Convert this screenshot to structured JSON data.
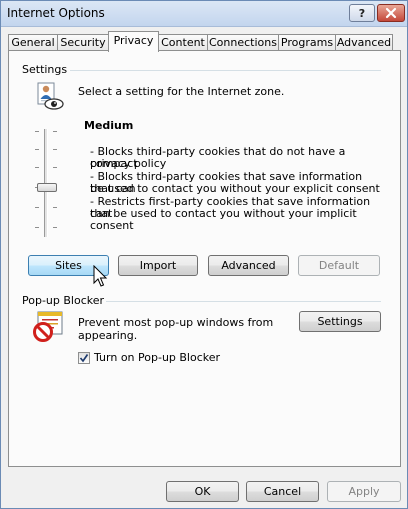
{
  "window": {
    "title": "Internet Options",
    "help_label": "?"
  },
  "tabs": [
    {
      "label": "General",
      "active": false
    },
    {
      "label": "Security",
      "active": false
    },
    {
      "label": "Privacy",
      "active": true
    },
    {
      "label": "Content",
      "active": false
    },
    {
      "label": "Connections",
      "active": false
    },
    {
      "label": "Programs",
      "active": false
    },
    {
      "label": "Advanced",
      "active": false
    }
  ],
  "settings": {
    "group_label": "Settings",
    "instruction": "Select a setting for the Internet zone.",
    "level_name": "Medium",
    "description_lines": [
      "- Blocks third-party cookies that do not have a compact",
      "privacy policy",
      "- Blocks third-party cookies that save information that can",
      "be used to contact you without your explicit consent",
      "- Restricts first-party cookies that save information that",
      "can be used to contact you without your implicit consent"
    ],
    "buttons": {
      "sites": "Sites",
      "import": "Import",
      "advanced": "Advanced",
      "default": "Default"
    }
  },
  "popup_blocker": {
    "group_label": "Pop-up Blocker",
    "description_line1": "Prevent most pop-up windows from",
    "description_line2": "appearing.",
    "settings_button": "Settings",
    "checkbox_label": "Turn on Pop-up Blocker",
    "checkbox_checked": true
  },
  "footer": {
    "ok": "OK",
    "cancel": "Cancel",
    "apply": "Apply"
  },
  "colors": {
    "focused_button": "#bee6fd",
    "close_button": "#c4483a",
    "titlebar": "#c3d5ee"
  },
  "icons": {
    "privacy_zone": "person-eye-icon",
    "popup_blocker": "popup-blocked-icon",
    "cursor": "mouse-pointer-icon"
  }
}
